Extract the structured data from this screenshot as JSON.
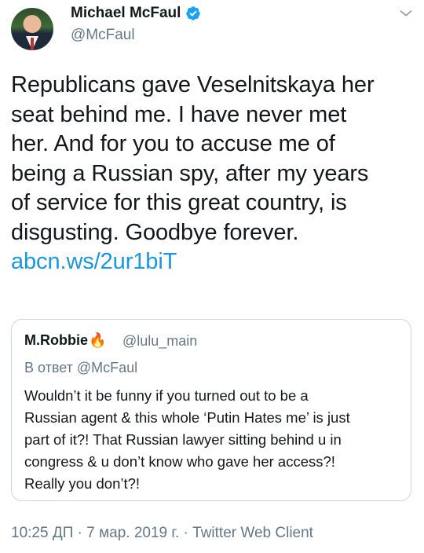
{
  "author": {
    "name": "Michael McFaul",
    "handle": "@McFaul"
  },
  "tweet": {
    "lines": [
      "Republicans gave Veselnitskaya her",
      "seat behind me. I have never met",
      "her. And for you to accuse me of",
      "being a Russian spy, after my years",
      "of service for this great country, is",
      "disgusting. Goodbye forever."
    ],
    "link": "abcn.ws/2ur1biT"
  },
  "quoted": {
    "name": "M.Robbie",
    "handle": "@lulu_main",
    "reply_to": "В ответ @McFaul",
    "lines": [
      "Wouldn’t it be funny if you turned out to be a",
      "Russian agent & this whole ‘Putin Hates me’ is just",
      "part of it?! That Russian lawyer sitting behind u in",
      "congress & u don’t know who gave her access?!",
      "Really you don’t?!"
    ]
  },
  "meta": {
    "text": "10:25 ДП · 7 мар. 2019 г. · Twitter Web Client"
  },
  "icons": {
    "verified": "verified-badge-icon",
    "menu": "chevron-down-icon",
    "emoji": "fire-emoji-icon"
  },
  "colors": {
    "link": "#1b95e0",
    "secondary": "#657786",
    "verified": "#1da1f2",
    "border": "#ccd6dd"
  }
}
